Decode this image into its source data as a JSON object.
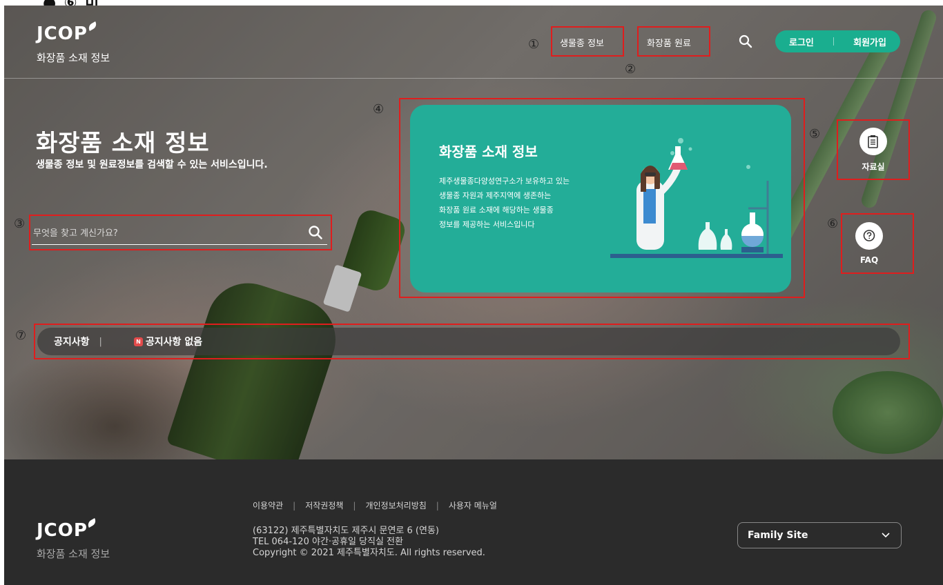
{
  "header": {
    "logo_text": "JCOP",
    "logo_sub": "화장품 소재 정보",
    "nav": [
      {
        "label": "생물종 정보",
        "marker": "①"
      },
      {
        "label": "화장품 원료",
        "marker": "②"
      }
    ],
    "auth": {
      "login": "로그인",
      "signup": "회원가입"
    }
  },
  "hero": {
    "title": "화장품 소재 정보",
    "subtitle": "생물종 정보 및 원료정보를 검색할 수 있는 서비스입니다.",
    "search_placeholder": "무엇을 찾고 계신가요?",
    "search_marker": "③"
  },
  "card": {
    "marker": "④",
    "title": "화장품 소재 정보",
    "desc_lines": [
      "제주생물종다양성연구소가 보유하고 있는",
      "생물종 자원과 제주지역에 생존하는",
      "화장품 원료 소재에 해당하는 생물종",
      "정보를 제공하는 서비스입니다"
    ]
  },
  "side": {
    "archive": {
      "label": "자료실",
      "marker": "⑤"
    },
    "faq": {
      "label": "FAQ",
      "marker": "⑥"
    }
  },
  "notice": {
    "marker": "⑦",
    "title": "공지사항",
    "badge": "N",
    "text": "공지사항 없음"
  },
  "footer": {
    "links": [
      "이용약관",
      "저작권정책",
      "개인정보처리방침",
      "사용자 메뉴얼"
    ],
    "address": "(63122) 제주특별자치도 제주시 문연로 6 (연동)",
    "tel": "TEL 064-120 야간·공휴일 당직실 전환",
    "copyright": "Copyright © 2021 제주특별자치도. All rights reserved.",
    "family_site": "Family Site",
    "logo_text": "JCOP",
    "logo_sub": "화장품 소재 정보"
  },
  "colors": {
    "accent": "#1aae8f",
    "card": "#23ad98",
    "footer": "#2b2b2b",
    "highlight": "#e01d1d"
  }
}
